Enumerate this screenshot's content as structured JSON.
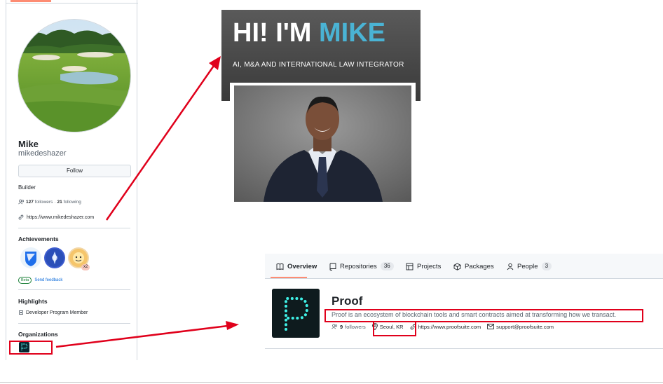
{
  "profile": {
    "name": "Mike",
    "login": "mikedeshazer",
    "follow_label": "Follow",
    "bio": "Builder",
    "followers_count": "127",
    "followers_label": "followers",
    "separator": "·",
    "following_count": "21",
    "following_label": "following",
    "website": "https://www.mikedeshazer.com",
    "achievements_title": "Achievements",
    "achievement_multiplier": "x2",
    "beta_label": "Beta",
    "feedback_label": "Send feedback",
    "highlights_title": "Highlights",
    "highlight_item": "Developer Program Member",
    "organizations_title": "Organizations"
  },
  "hero": {
    "title_prefix": "HI! I'M",
    "title_name": "MIKE",
    "subtitle": "AI, M&A AND INTERNATIONAL LAW INTEGRATOR"
  },
  "org": {
    "tabs": [
      {
        "label": "Overview",
        "icon": "book-icon"
      },
      {
        "label": "Repositories",
        "count": "36",
        "icon": "repo-icon"
      },
      {
        "label": "Projects",
        "icon": "table-icon"
      },
      {
        "label": "Packages",
        "icon": "package-icon"
      },
      {
        "label": "People",
        "count": "3",
        "icon": "person-icon"
      }
    ],
    "name": "Proof",
    "description": "Proof is an ecosystem of blockchain tools and smart contracts aimed at transforming how we transact.",
    "followers_count": "9",
    "followers_label": "followers",
    "location": "Seoul, KR",
    "website": "https://www.proofsuite.com",
    "email": "support@proofsuite.com",
    "logo_letter": "P"
  },
  "colors": {
    "annotation_red": "#e0001b",
    "accent_blue": "#4ab3d4",
    "tab_underline": "#fd8c73",
    "link_blue": "#0969da"
  }
}
